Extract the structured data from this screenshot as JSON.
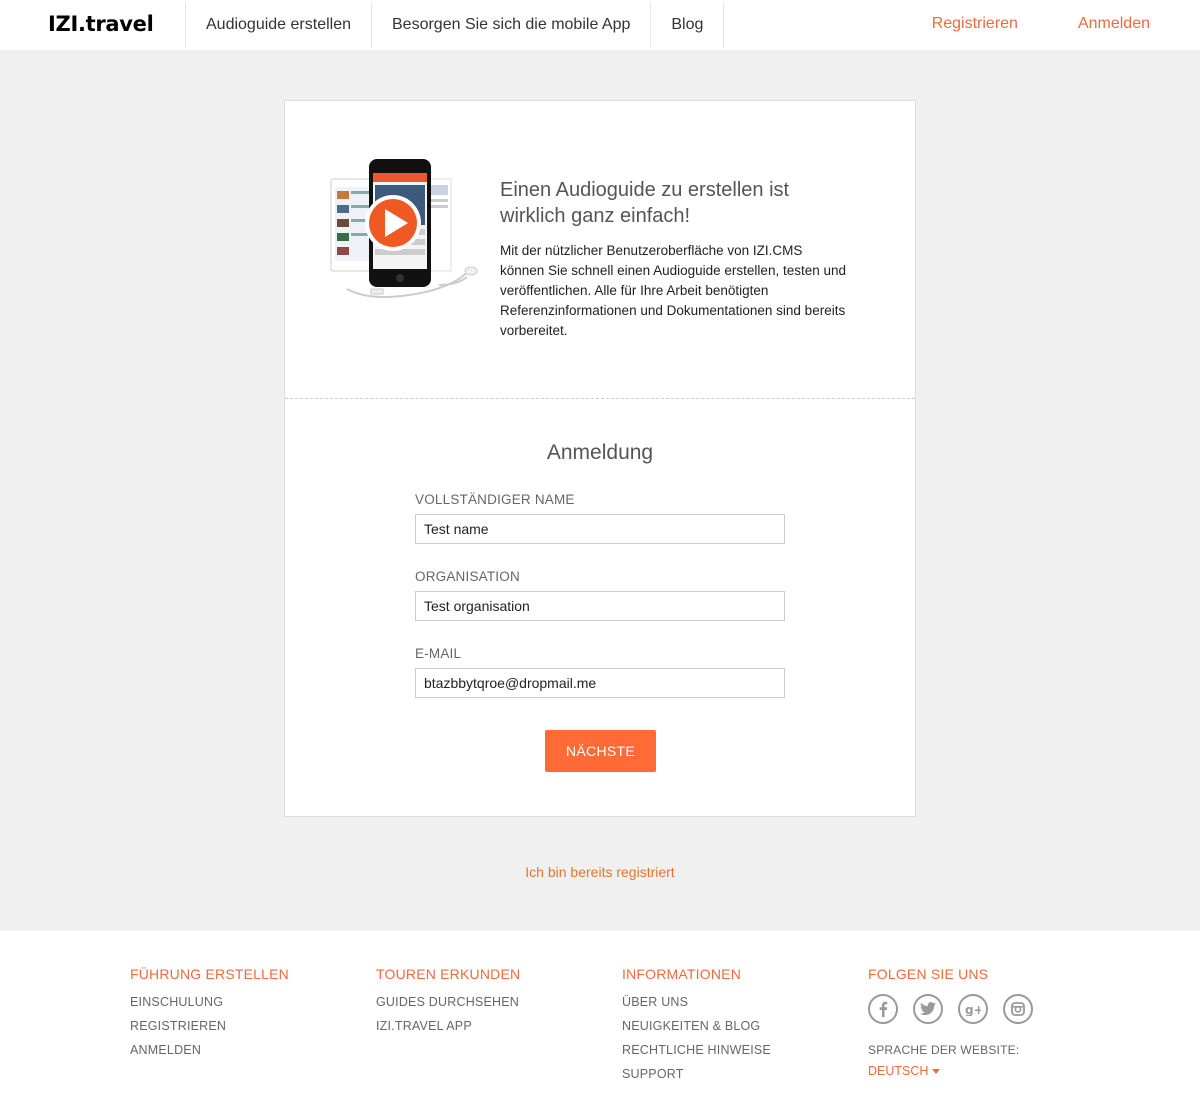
{
  "header": {
    "logo": "IZI.travel",
    "nav": [
      {
        "label": "Audioguide erstellen"
      },
      {
        "label": "Besorgen Sie sich die mobile App"
      },
      {
        "label": "Blog"
      }
    ],
    "register": "Registrieren",
    "login": "Anmelden"
  },
  "promo": {
    "title": "Einen Audioguide zu erstellen ist wirklich ganz einfach!",
    "text": "Mit der nützlicher Benutzeroberfläche von IZI.CMS können Sie schnell einen Audioguide erstellen, testen und veröffentlichen. Alle für Ihre Arbeit benötigten Referenzinformationen und Dokumentationen sind bereits vorbereitet.",
    "illustration_icon": "phone-with-play-icon"
  },
  "form": {
    "title": "Anmeldung",
    "fields": [
      {
        "label": "VOLLSTÄNDIGER NAME",
        "value": "Test name"
      },
      {
        "label": "ORGANISATION",
        "value": "Test organisation"
      },
      {
        "label": "E-MAIL",
        "value": "btazbbytqroe@dropmail.me"
      }
    ],
    "submit": "NÄCHSTE"
  },
  "already_registered": "Ich bin bereits registriert",
  "footer": {
    "columns": [
      {
        "heading": "FÜHRUNG ERSTELLEN",
        "links": [
          "EINSCHULUNG",
          "REGISTRIEREN",
          "ANMELDEN"
        ]
      },
      {
        "heading": "TOUREN ERKUNDEN",
        "links": [
          "GUIDES DURCHSEHEN",
          "IZI.TRAVEL APP"
        ]
      },
      {
        "heading": "INFORMATIONEN",
        "links": [
          "ÜBER UNS",
          "NEUIGKEITEN & BLOG",
          "RECHTLICHE HINWEISE",
          "SUPPORT"
        ]
      }
    ],
    "follow": {
      "heading": "FOLGEN SIE UNS",
      "icons": [
        "facebook-icon",
        "twitter-icon",
        "google-plus-icon",
        "instagram-icon"
      ]
    },
    "language_label": "SPRACHE DER WEBSITE:",
    "language_value": "DEUTSCH"
  },
  "colors": {
    "accent": "#ff6a36",
    "link": "#f26a3d",
    "background": "#f0f0f0"
  }
}
